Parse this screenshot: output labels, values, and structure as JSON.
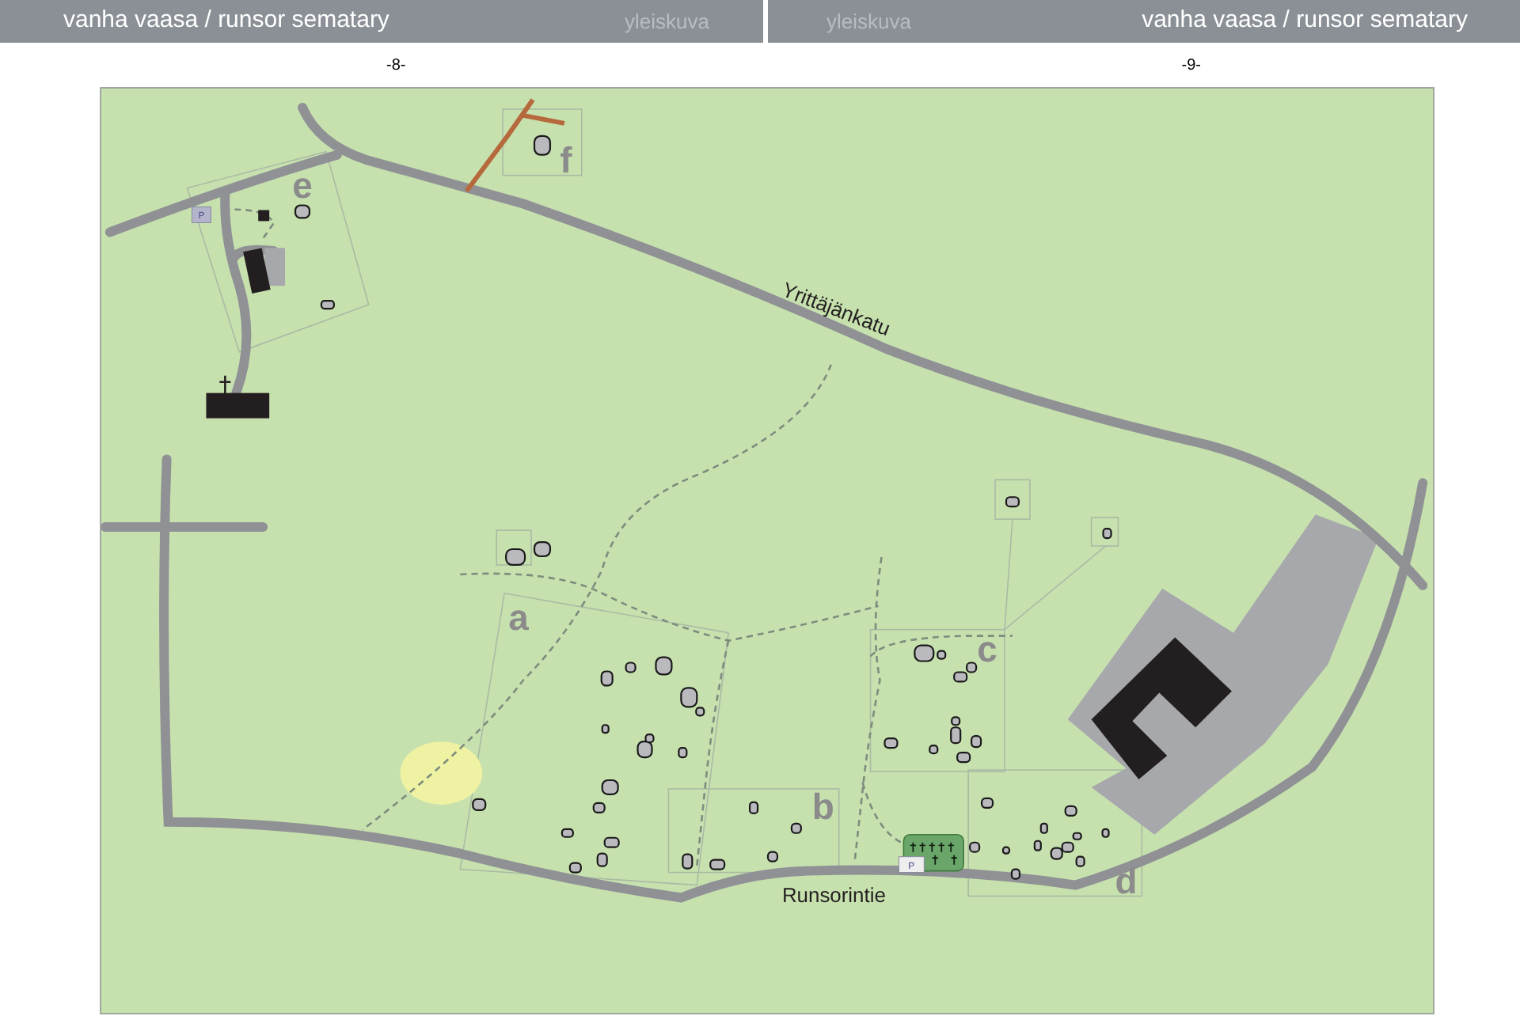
{
  "header": {
    "left_title": "vanha vaasa / runsor sematary",
    "left_subtitle": "yleiskuva",
    "right_subtitle": "yleiskuva",
    "right_title": "vanha vaasa / runsor sematary"
  },
  "page_numbers": [
    "-8-",
    "-9-"
  ],
  "map": {
    "streets": [
      "Yrittäjänkatu",
      "Runsorintie"
    ],
    "areas": [
      "e",
      "f",
      "a",
      "b",
      "c",
      "d"
    ],
    "parking_signs": [
      "P",
      "P"
    ]
  }
}
